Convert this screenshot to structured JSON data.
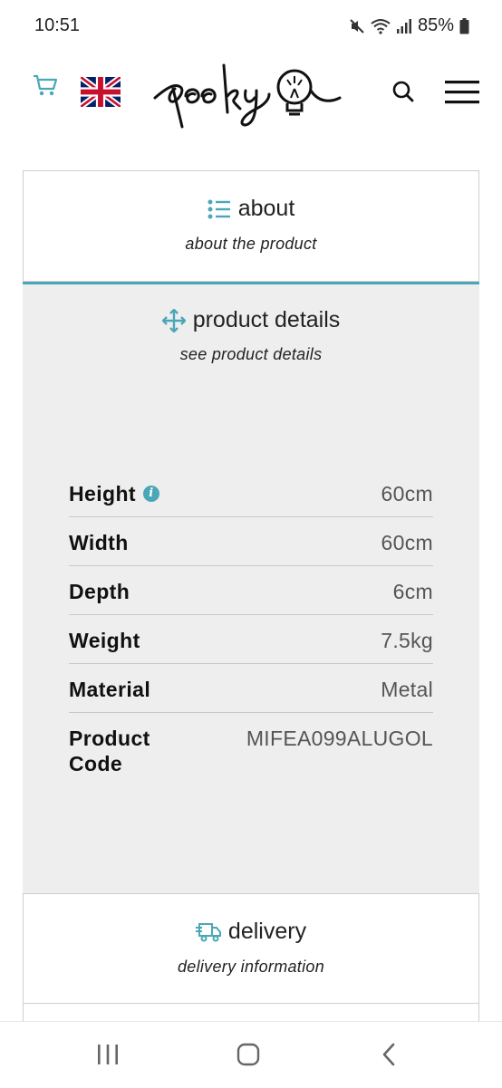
{
  "status": {
    "time": "10:51",
    "battery": "85%"
  },
  "header": {
    "icons": [
      "cart-icon",
      "uk-flag-icon",
      "search-icon",
      "menu-icon"
    ],
    "logo_text": "pooky",
    "accent": "#4aa7b8"
  },
  "about": {
    "title": "about",
    "subtitle": "about the product"
  },
  "details": {
    "title": "product details",
    "subtitle": "see product details",
    "specs": [
      {
        "label": "Height",
        "value": "60cm"
      },
      {
        "label": "Width",
        "value": "60cm"
      },
      {
        "label": "Depth",
        "value": "6cm"
      },
      {
        "label": "Weight",
        "value": "7.5kg"
      },
      {
        "label": "Material",
        "value": "Metal"
      },
      {
        "label": "Product Code",
        "value": "MIFEA099ALUGOL"
      }
    ]
  },
  "delivery": {
    "title": "delivery",
    "subtitle": "delivery information"
  }
}
